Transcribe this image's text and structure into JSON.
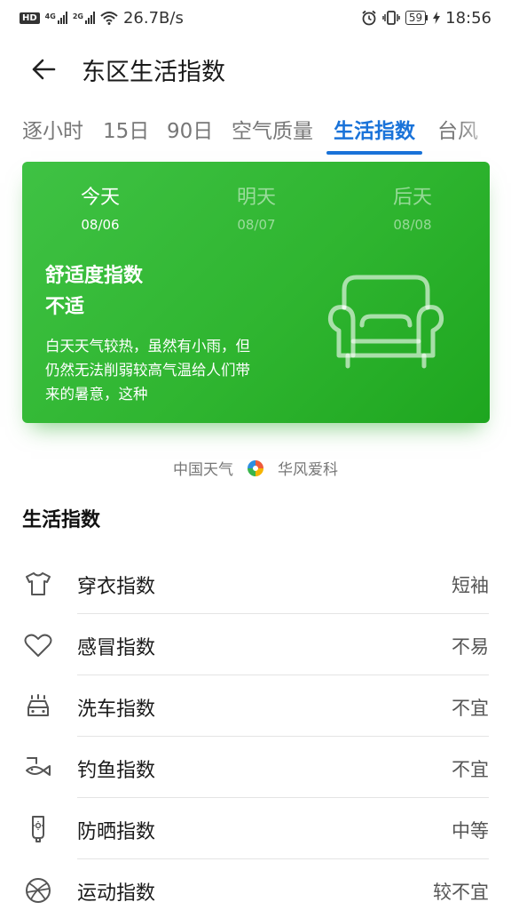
{
  "status_bar": {
    "hd": "HD",
    "sig1": "4G",
    "sig2": "2G",
    "speed": "26.7B/s",
    "battery": "59",
    "time": "18:56"
  },
  "header": {
    "title": "东区生活指数"
  },
  "tabs": [
    {
      "label": "逐小时"
    },
    {
      "label": "15日"
    },
    {
      "label": "90日"
    },
    {
      "label": "空气质量"
    },
    {
      "label": "生活指数"
    },
    {
      "label": "台风"
    }
  ],
  "active_tab": "生活指数",
  "card": {
    "days": [
      {
        "name": "今天",
        "date": "08/06"
      },
      {
        "name": "明天",
        "date": "08/07"
      },
      {
        "name": "后天",
        "date": "08/08"
      }
    ],
    "index_title": "舒适度指数",
    "index_value": "不适",
    "description": "白天天气较热，虽然有小雨，但仍然无法削弱较高气温给人们带来的暑意，这种",
    "icon": "armchair-icon",
    "color_top": "#3fc244",
    "color_bottom": "#1ea61f"
  },
  "source": {
    "left": "中国天气",
    "right": "华风爱科",
    "icon": "swirl-logo-icon"
  },
  "section_title": "生活指数",
  "items": [
    {
      "label": "穿衣指数",
      "value": "短袖",
      "icon": "tshirt-icon"
    },
    {
      "label": "感冒指数",
      "value": "不易",
      "icon": "heart-icon"
    },
    {
      "label": "洗车指数",
      "value": "不宜",
      "icon": "car-wash-icon"
    },
    {
      "label": "钓鱼指数",
      "value": "不宜",
      "icon": "fishing-icon"
    },
    {
      "label": "防晒指数",
      "value": "中等",
      "icon": "sunscreen-icon"
    },
    {
      "label": "运动指数",
      "value": "较不宜",
      "icon": "ball-icon"
    }
  ],
  "colors": {
    "accent": "#1a73d9",
    "card_green": "#2fb530"
  }
}
